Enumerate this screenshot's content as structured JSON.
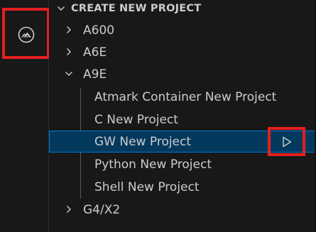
{
  "panel": {
    "section_title": "CREATE NEW PROJECT"
  },
  "tree": {
    "a600": "A600",
    "a6e": "A6E",
    "a9e": "A9E",
    "a9e_children": [
      "Atmark Container New Project",
      "C New Project",
      "GW New Project",
      "Python New Project",
      "Shell New Project"
    ],
    "g4x2": "G4/X2"
  },
  "icons": {
    "activity": "atmark-mountain-icon",
    "play": "play-icon",
    "chevron_right": "chevron-right-icon",
    "chevron_down": "chevron-down-icon"
  },
  "colors": {
    "background": "#181818",
    "selection": "#04395e",
    "selection_border": "#0078d4",
    "highlight_box": "#e51f1f",
    "text": "#cccccc"
  }
}
